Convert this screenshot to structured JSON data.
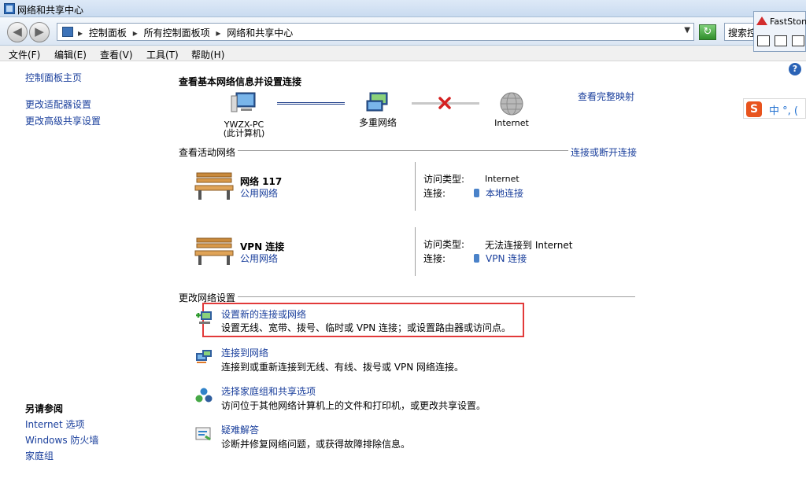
{
  "window": {
    "title": "网络和共享中心"
  },
  "address": {
    "crumbs": [
      "控制面板",
      "所有控制面板项",
      "网络和共享中心"
    ],
    "separator": "▸",
    "search_placeholder": "搜索控制面板"
  },
  "faststone": {
    "label": "FastStone"
  },
  "menu": [
    "文件(F)",
    "编辑(E)",
    "查看(V)",
    "工具(T)",
    "帮助(H)"
  ],
  "sidebar": {
    "home": "控制面板主页",
    "links": [
      "更改适配器设置",
      "更改高级共享设置"
    ],
    "see_also_title": "另请参阅",
    "see_also": [
      "Internet 选项",
      "Windows 防火墙",
      "家庭组"
    ]
  },
  "ime": {
    "logo": "S",
    "text": "中 °, ( "
  },
  "main": {
    "heading": "查看基本网络信息并设置连接",
    "view_full_map": "查看完整映射",
    "map": {
      "pc_name": "YWZX-PC",
      "pc_caption": "(此计算机)",
      "middle": "多重网络",
      "internet": "Internet"
    },
    "active_networks_label": "查看活动网络",
    "connect_or_disconnect": "连接或断开连接",
    "networks": [
      {
        "name": "网络  117",
        "type": "公用网络",
        "access_label": "访问类型:",
        "access_value": "Internet",
        "connection_label": "连接:",
        "connection_value": "本地连接"
      },
      {
        "name": "VPN 连接",
        "type": "公用网络",
        "access_label": "访问类型:",
        "access_value": "无法连接到 Internet",
        "connection_label": "连接:",
        "connection_value": "VPN 连接"
      }
    ],
    "change_settings_label": "更改网络设置",
    "tasks": [
      {
        "title": "设置新的连接或网络",
        "desc": "设置无线、宽带、拨号、临时或 VPN 连接；或设置路由器或访问点。"
      },
      {
        "title": "连接到网络",
        "desc": "连接到或重新连接到无线、有线、拨号或 VPN 网络连接。"
      },
      {
        "title": "选择家庭组和共享选项",
        "desc": "访问位于其他网络计算机上的文件和打印机，或更改共享设置。"
      },
      {
        "title": "疑难解答",
        "desc": "诊断并修复网络问题，或获得故障排除信息。"
      }
    ]
  },
  "colors": {
    "link": "#1a3f9c",
    "highlight": "#e23a3a",
    "error_x": "#d42020"
  }
}
